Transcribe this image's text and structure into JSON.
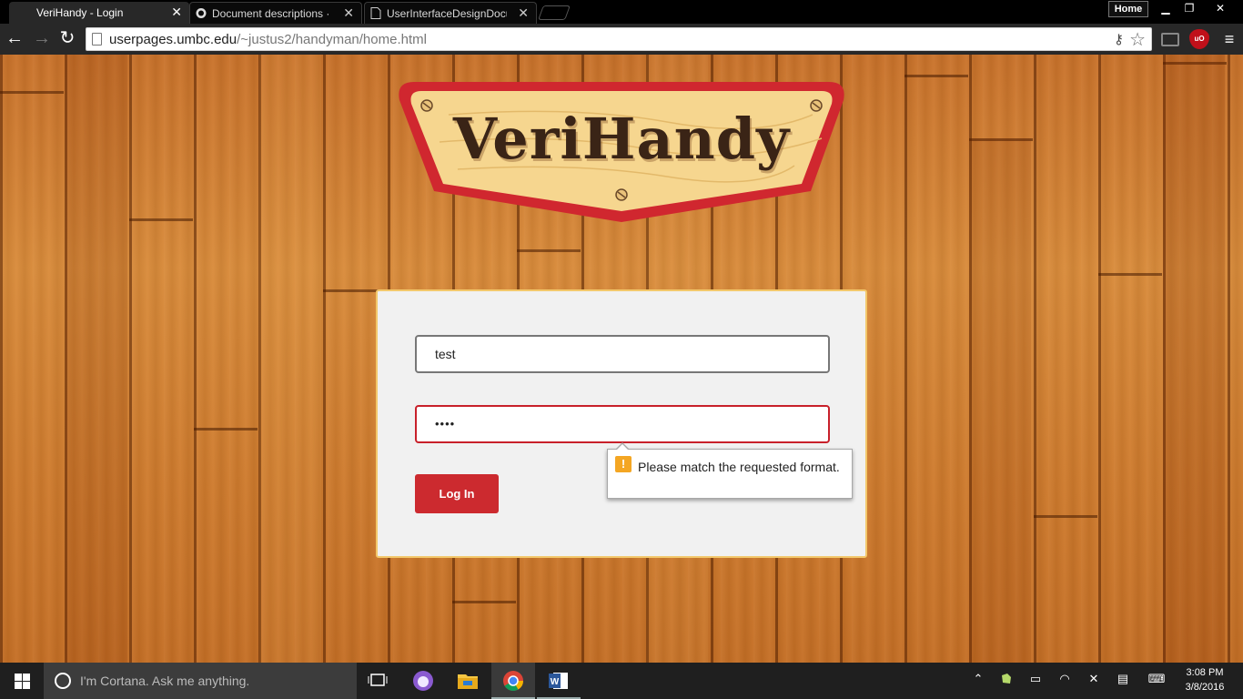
{
  "browser": {
    "tabs": [
      {
        "title": "VeriHandy - Login",
        "active": true
      },
      {
        "title": "Document descriptions · U",
        "active": false
      },
      {
        "title": "UserInterfaceDesignDocur",
        "active": false
      }
    ],
    "home_label": "Home",
    "url_host": "userpages.umbc.edu",
    "url_path": "/~justus2/handyman/home.html"
  },
  "logo": {
    "text": "VeriHandy",
    "colors": {
      "border": "#d0272f",
      "board": "#f6d68f",
      "text": "#3a2416"
    }
  },
  "login": {
    "username_value": "test",
    "password_value": "••••",
    "login_button": "Log In",
    "validation_message": "Please match the requested format.",
    "colors": {
      "button": "#cc2a2f",
      "error_border": "#c8202a",
      "card_border": "#f3c86b"
    }
  },
  "taskbar": {
    "cortana_placeholder": "I'm Cortana. Ask me anything.",
    "time": "3:08 PM",
    "date": "3/8/2016"
  }
}
